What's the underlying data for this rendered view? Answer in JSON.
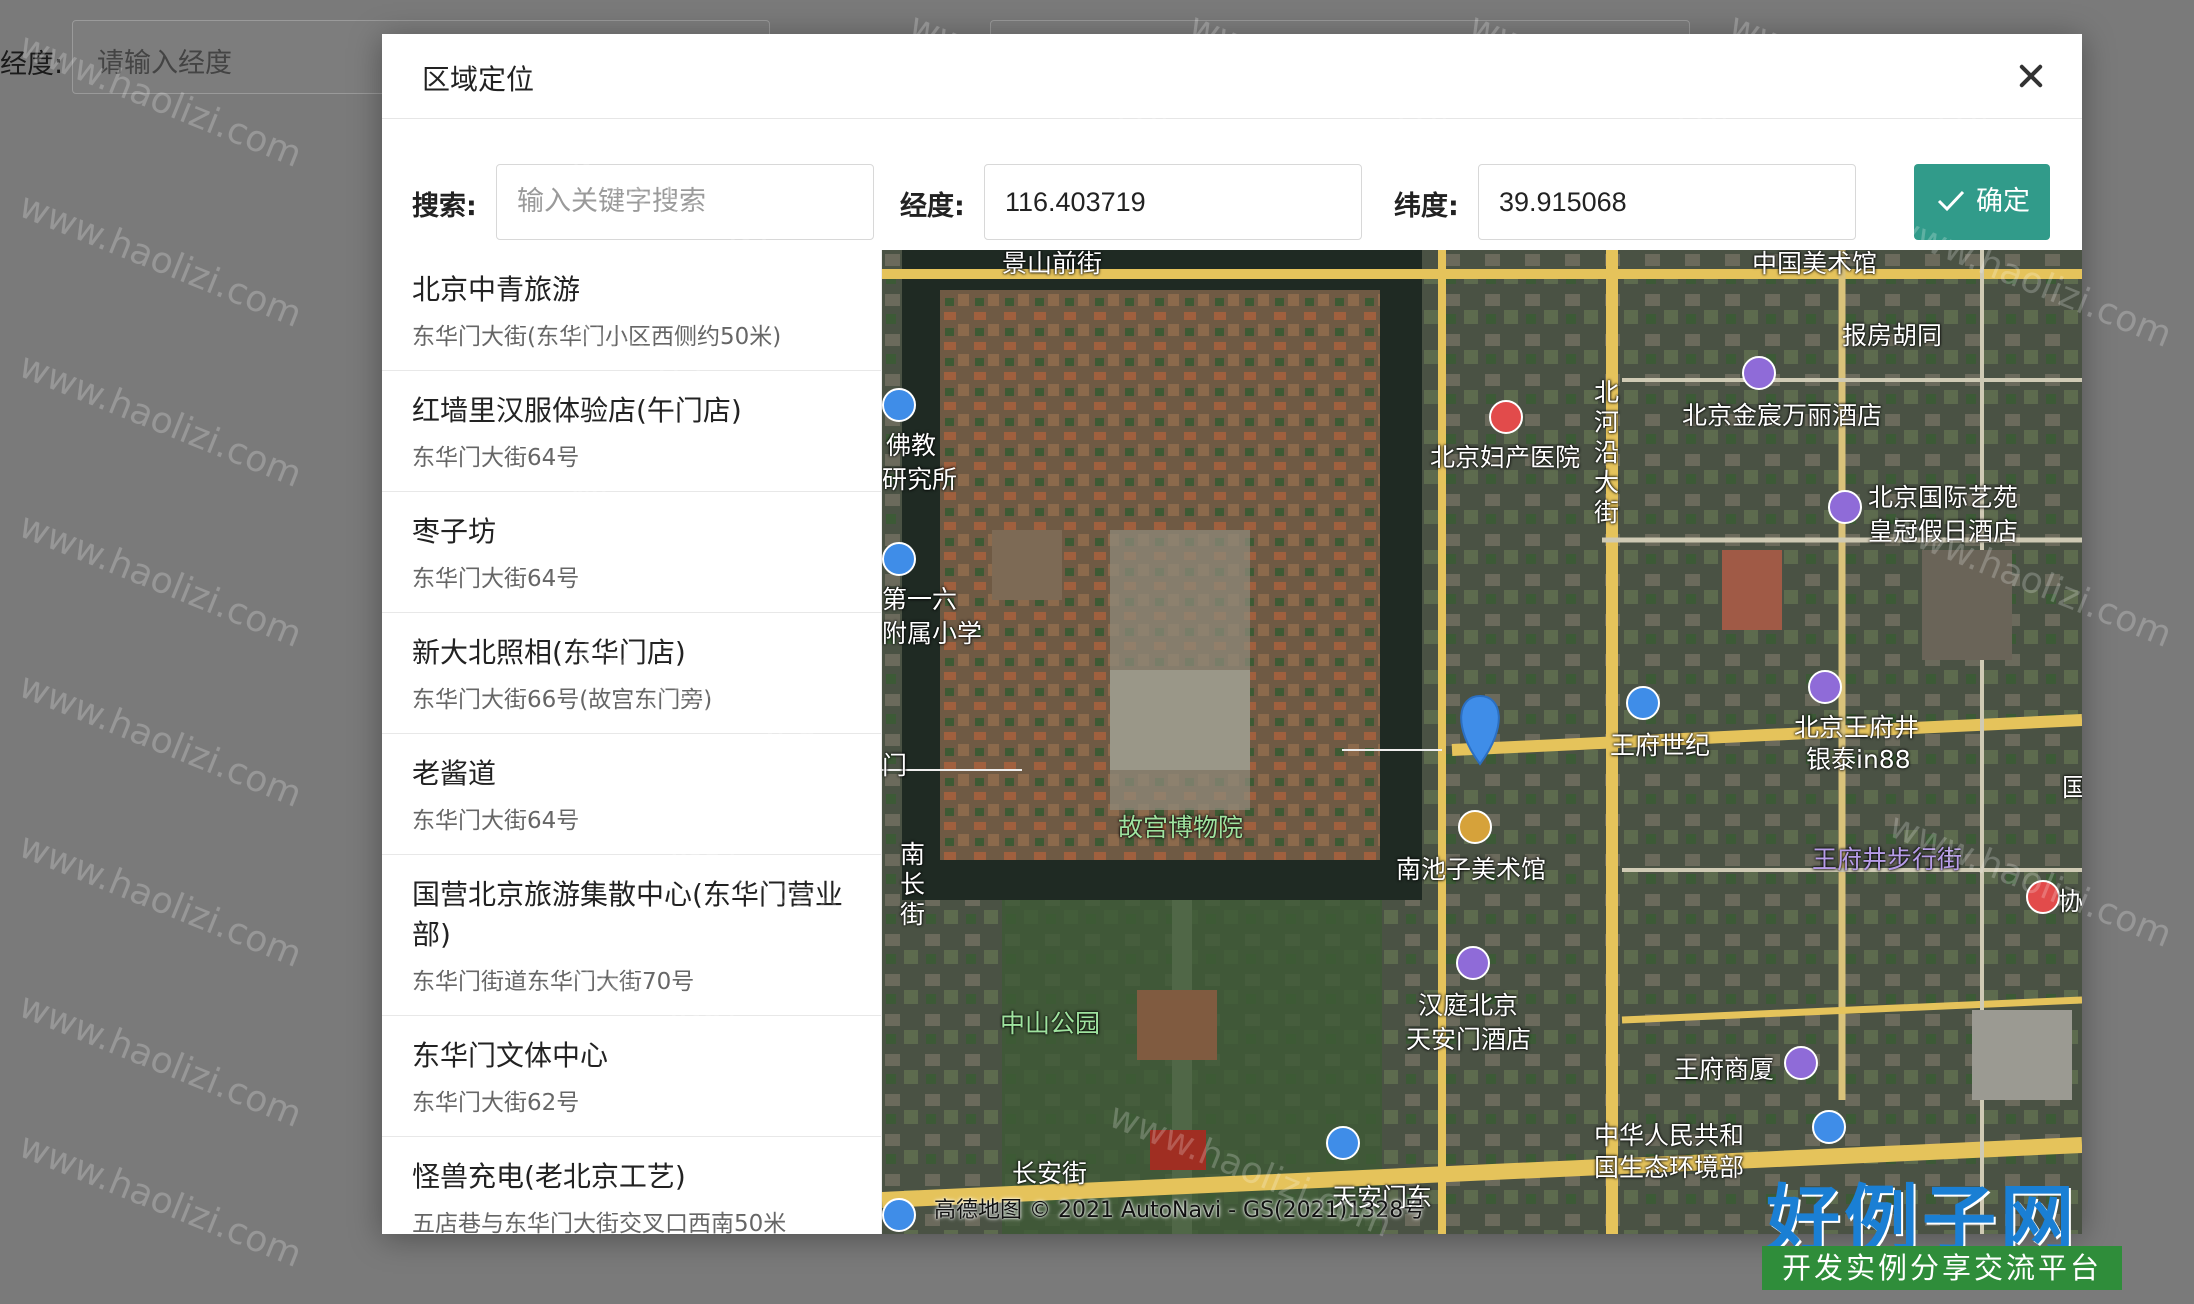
{
  "background": {
    "longitude_label": "经度:",
    "longitude_placeholder": "请输入经度"
  },
  "watermark": "www.haolizi.com",
  "modal": {
    "title": "区域定位",
    "search_label": "搜索:",
    "search_placeholder": "输入关键字搜索",
    "longitude_label": "经度:",
    "longitude_value": "116.403719",
    "latitude_label": "纬度:",
    "latitude_value": "39.915068",
    "confirm_label": "确定"
  },
  "results": [
    {
      "name": "北京中青旅游",
      "address": "东华门大街(东华门小区西侧约50米)"
    },
    {
      "name": "红墙里汉服体验店(午门店)",
      "address": "东华门大街64号"
    },
    {
      "name": "枣子坊",
      "address": "东华门大街64号"
    },
    {
      "name": "新大北照相(东华门店)",
      "address": "东华门大街66号(故宫东门旁)"
    },
    {
      "name": "老酱道",
      "address": "东华门大街64号"
    },
    {
      "name": "国营北京旅游集散中心(东华门营业部)",
      "address": "东华门街道东华门大街70号"
    },
    {
      "name": "东华门文体中心",
      "address": "东华门大街62号"
    },
    {
      "name": "怪兽充电(老北京工艺)",
      "address": "五店巷与东华门大街交叉口西南50米"
    }
  ],
  "map": {
    "labels": {
      "jingshan": "景山前街",
      "art_museum": "中国美术馆",
      "baofang": "报房胡同",
      "kingwing": "北京金宸万丽酒店",
      "fuchan": "北京妇产医院",
      "beiheyan": "北河沿大街",
      "guoji": "北京国际艺苑",
      "crowne": "皇冠假日酒店",
      "fojiao": "佛教",
      "yanjiusuo": "研究所",
      "diyiliu": "第一六",
      "fushu": "附属小学",
      "wangfu_world": "王府世纪",
      "intime": "北京王府井",
      "intime2": "银泰in88",
      "palace": "故宫博物院",
      "nanchizi_museum": "南池子美术馆",
      "wfj_street": "王府井步行街",
      "nanchang": "南长街",
      "zhongshan": "中山公园",
      "hanting": "汉庭北京",
      "tiananmen_hotel": "天安门酒店",
      "wangfu_mall": "王府商厦",
      "changan": "长安街",
      "tiananmen_east": "天安门东",
      "ministry": "中华人民共和",
      "ministry2": "国生态环境部",
      "xie": "协",
      "guo": "国",
      "men": "门"
    },
    "copyright": "高德地图 © 2021 AutoNavi - GS(2021)1328号"
  },
  "brand": {
    "logo": "好例子网",
    "tagline": "开发实例分享交流平台"
  }
}
